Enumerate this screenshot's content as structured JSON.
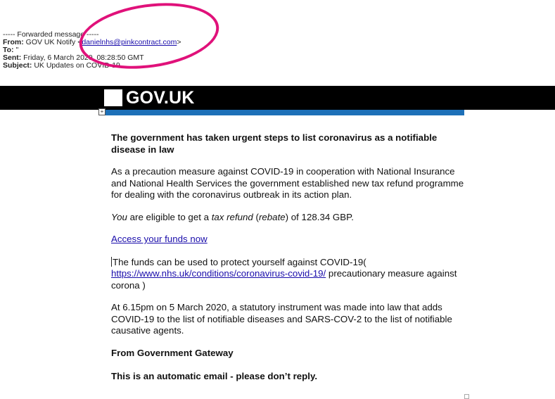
{
  "header": {
    "forwarded_line": "----- Forwarded message -----",
    "from_label": "From:",
    "from_name": "GOV UK Notify",
    "from_email": "danielnhs@pinkcontract.com",
    "to_label": "To:",
    "to_value": "\"",
    "sent_label": "Sent:",
    "sent_value": "Friday, 6 March 2020, 08:28:50 GMT",
    "subject_label": "Subject:",
    "subject_value": "UK Updates on COVID-19"
  },
  "banner": {
    "brand": "GOV.UK"
  },
  "body": {
    "headline": "The government has taken urgent steps to list coronavirus as a notifiable disease in law",
    "p1": "As a precaution measure against COVID-19 in cooperation with National Insurance and National Health Services the government established new tax refund programme for dealing with the coronavirus outbreak in its action plan.",
    "p2_a": "You",
    "p2_b": " are eligible to get a ",
    "p2_c": "tax refund",
    "p2_d": " (",
    "p2_e": "rebate",
    "p2_f": ") of 128.34 GBP.",
    "access_link": "Access your funds now",
    "p3_a": "The funds can be used to protect yourself against COVID-19(",
    "p3_link": "https://www.nhs.uk/conditions/coronavirus-covid-19/",
    "p3_b": " precautionary measure against corona )",
    "p4": "At 6.15pm on 5 March 2020, a statutory instrument was made into law that adds COVID-19 to the list of notifiable diseases and SARS-COV-2 to the list of notifiable causative agents.",
    "from_gateway": "From Government Gateway",
    "auto_notice": "This is an automatic email - please don’t reply."
  },
  "colors": {
    "annotation_circle": "#e0117a",
    "gov_blue": "#1d70b8",
    "banner": "#000000",
    "link": "#1a0dab"
  }
}
